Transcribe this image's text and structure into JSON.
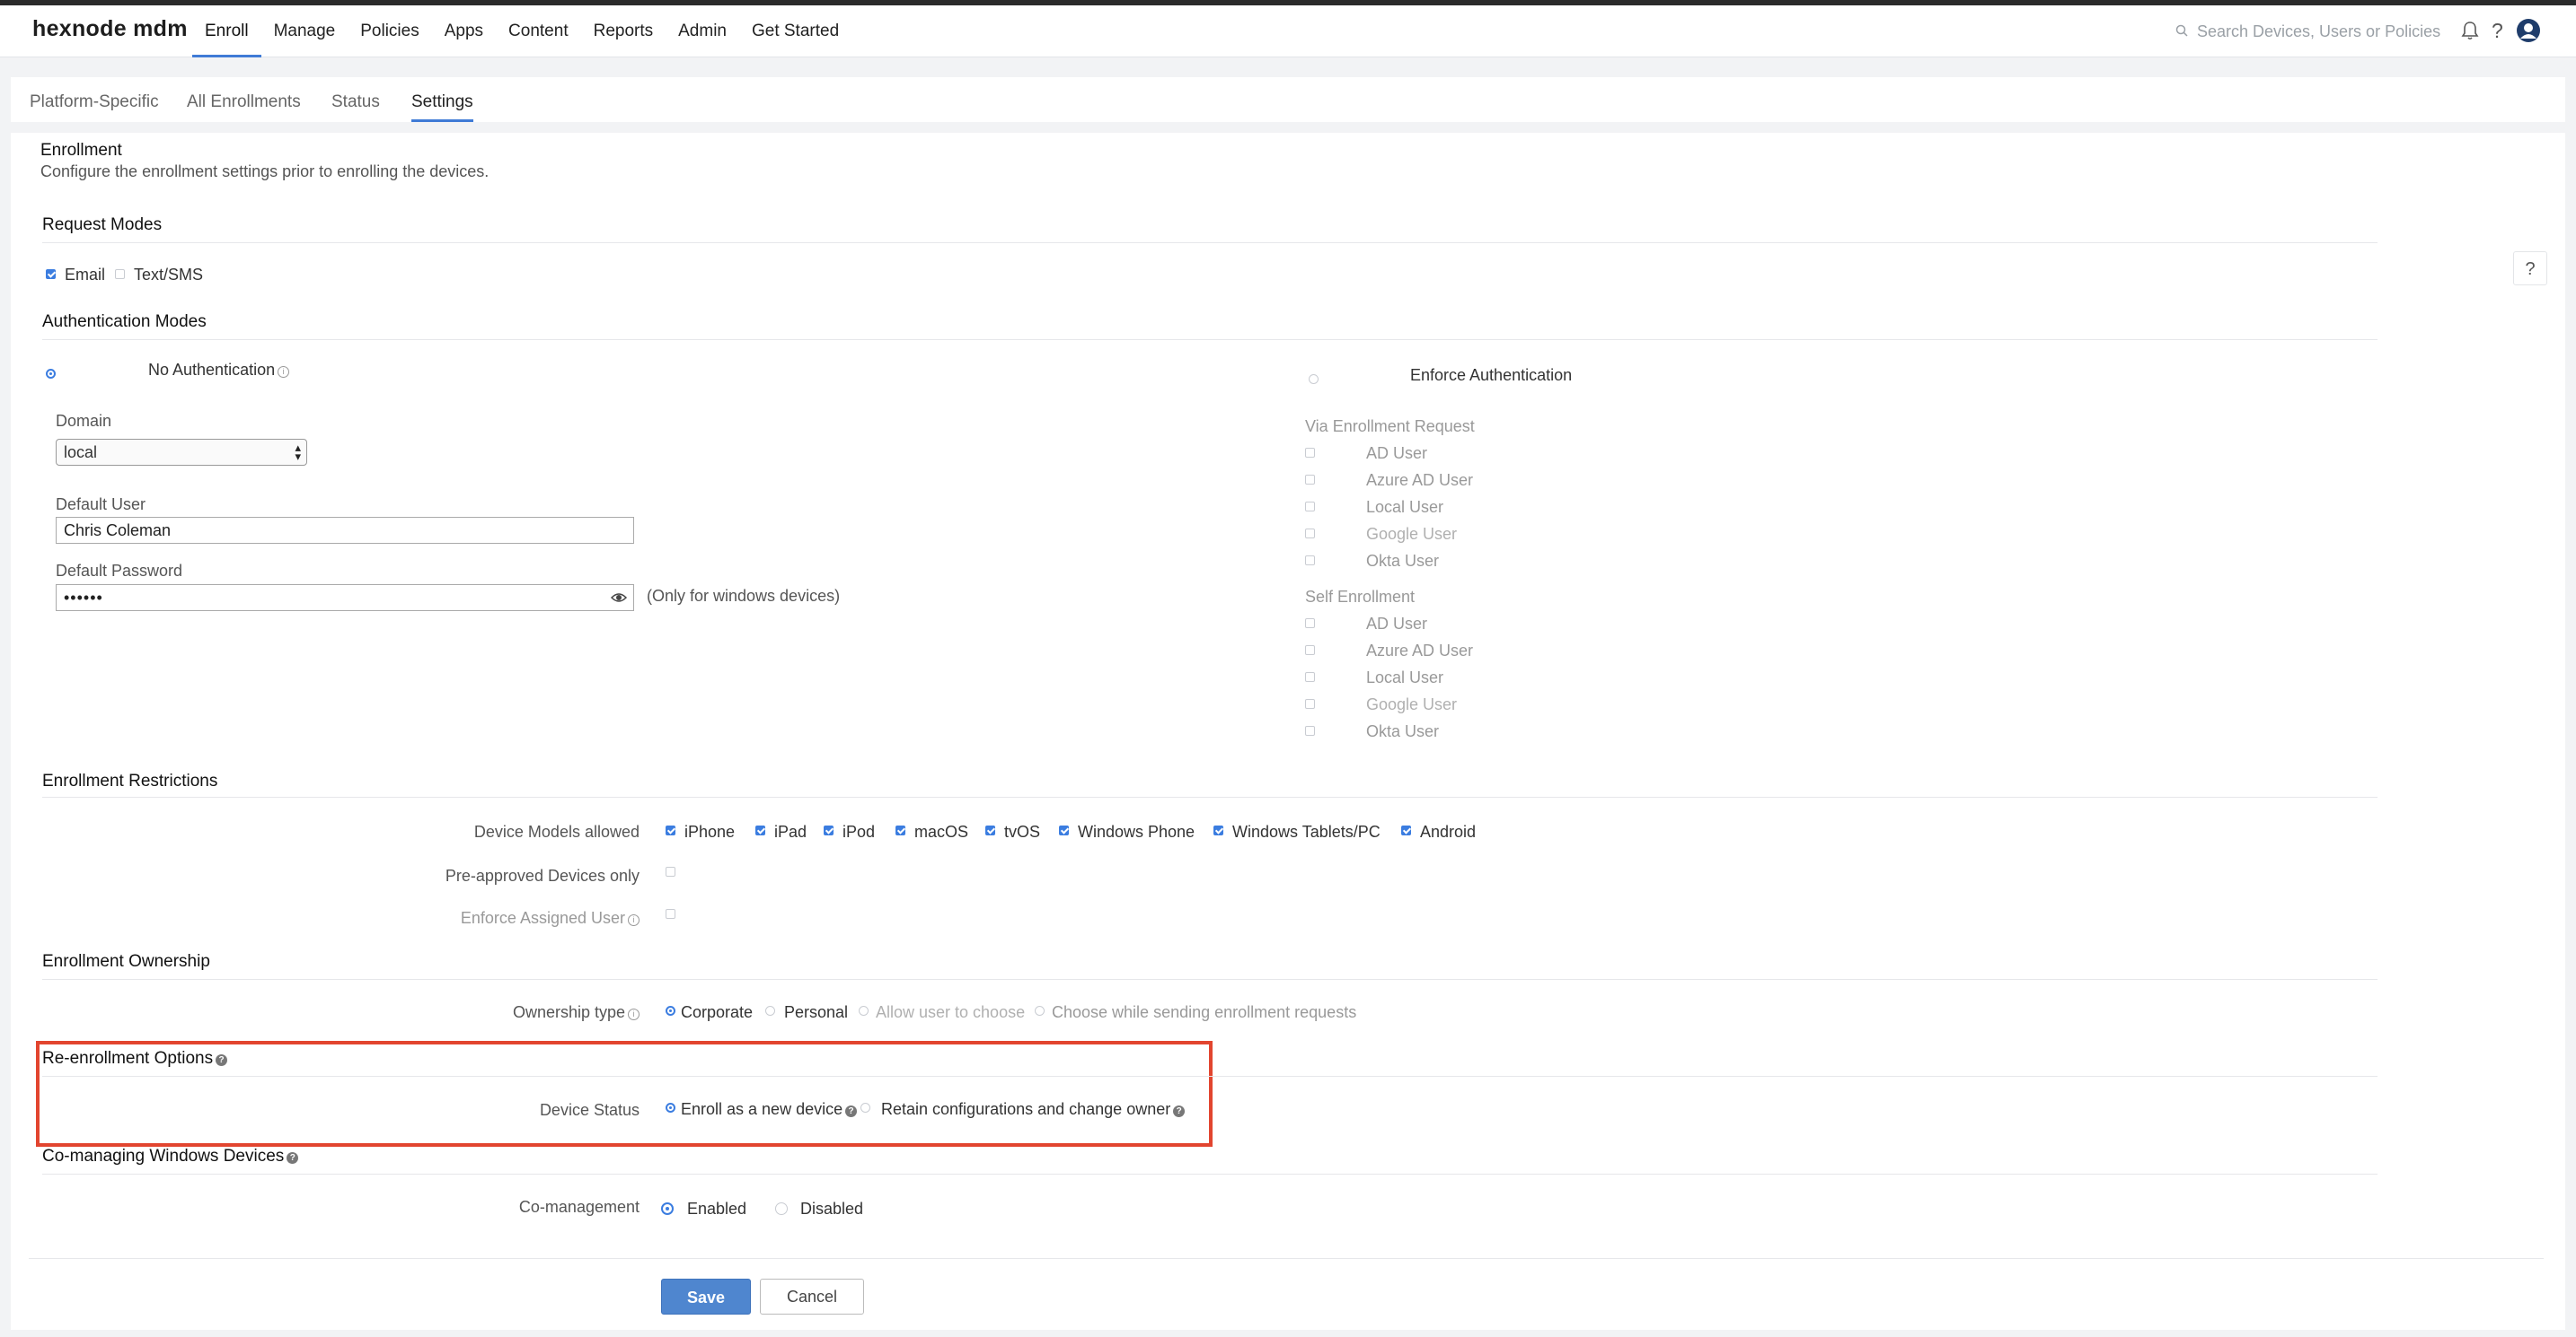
{
  "app": {
    "logo": "hexnode mdm",
    "nav": [
      "Enroll",
      "Manage",
      "Policies",
      "Apps",
      "Content",
      "Reports",
      "Admin",
      "Get Started"
    ],
    "search_placeholder": "Search Devices, Users or Policies"
  },
  "subnav": {
    "tabs": [
      "Platform-Specific",
      "All Enrollments",
      "Status",
      "Settings"
    ],
    "active": "Settings"
  },
  "enrollment": {
    "title": "Enrollment",
    "description": "Configure the enrollment settings prior to enrolling the devices."
  },
  "help_button": "?",
  "request_modes": {
    "title": "Request Modes",
    "options": [
      {
        "label": "Email",
        "checked": true
      },
      {
        "label": "Text/SMS",
        "checked": false
      }
    ]
  },
  "auth_modes": {
    "title": "Authentication Modes",
    "no_auth": {
      "label": "No Authentication",
      "selected": true
    },
    "domain_label": "Domain",
    "domain_value": "local",
    "default_user_label": "Default User",
    "default_user_value": "Chris Coleman",
    "default_password_label": "Default Password",
    "default_password_value": "••••••",
    "password_note": "(Only for windows devices)",
    "enforce": {
      "label": "Enforce Authentication",
      "selected": false
    },
    "via_request_title": "Via Enrollment Request",
    "via_request_options": [
      "AD User",
      "Azure AD User",
      "Local User",
      "Google User",
      "Okta User"
    ],
    "self_enroll_title": "Self Enrollment",
    "self_enroll_options": [
      "AD User",
      "Azure AD User",
      "Local User",
      "Google User",
      "Okta User"
    ]
  },
  "restrictions": {
    "title": "Enrollment Restrictions",
    "models_label": "Device Models allowed",
    "models": [
      {
        "label": "iPhone",
        "checked": true
      },
      {
        "label": "iPad",
        "checked": true
      },
      {
        "label": "iPod",
        "checked": true
      },
      {
        "label": "macOS",
        "checked": true
      },
      {
        "label": "tvOS",
        "checked": true
      },
      {
        "label": "Windows Phone",
        "checked": true
      },
      {
        "label": "Windows Tablets/PC",
        "checked": true
      },
      {
        "label": "Android",
        "checked": true
      }
    ],
    "preapproved_label": "Pre-approved Devices only",
    "enforce_user_label": "Enforce Assigned User"
  },
  "ownership": {
    "title": "Enrollment Ownership",
    "type_label": "Ownership type",
    "options": [
      {
        "label": "Corporate",
        "selected": true
      },
      {
        "label": "Personal",
        "selected": false
      },
      {
        "label": "Allow user to choose",
        "selected": false
      },
      {
        "label": "Choose while sending enrollment requests",
        "selected": false
      }
    ]
  },
  "reenroll": {
    "title": "Re-enrollment Options",
    "device_status_label": "Device Status",
    "options": [
      {
        "label": "Enroll as a new device",
        "selected": true
      },
      {
        "label": "Retain configurations and change owner",
        "selected": false
      }
    ]
  },
  "comanage": {
    "title": "Co-managing Windows Devices",
    "label": "Co-management",
    "options": [
      {
        "label": "Enabled",
        "selected": true
      },
      {
        "label": "Disabled",
        "selected": false
      }
    ]
  },
  "actions": {
    "save": "Save",
    "cancel": "Cancel"
  },
  "colors": {
    "accent": "#3b7de0",
    "highlight": "#e2452f",
    "save_button": "#4f86cf"
  }
}
